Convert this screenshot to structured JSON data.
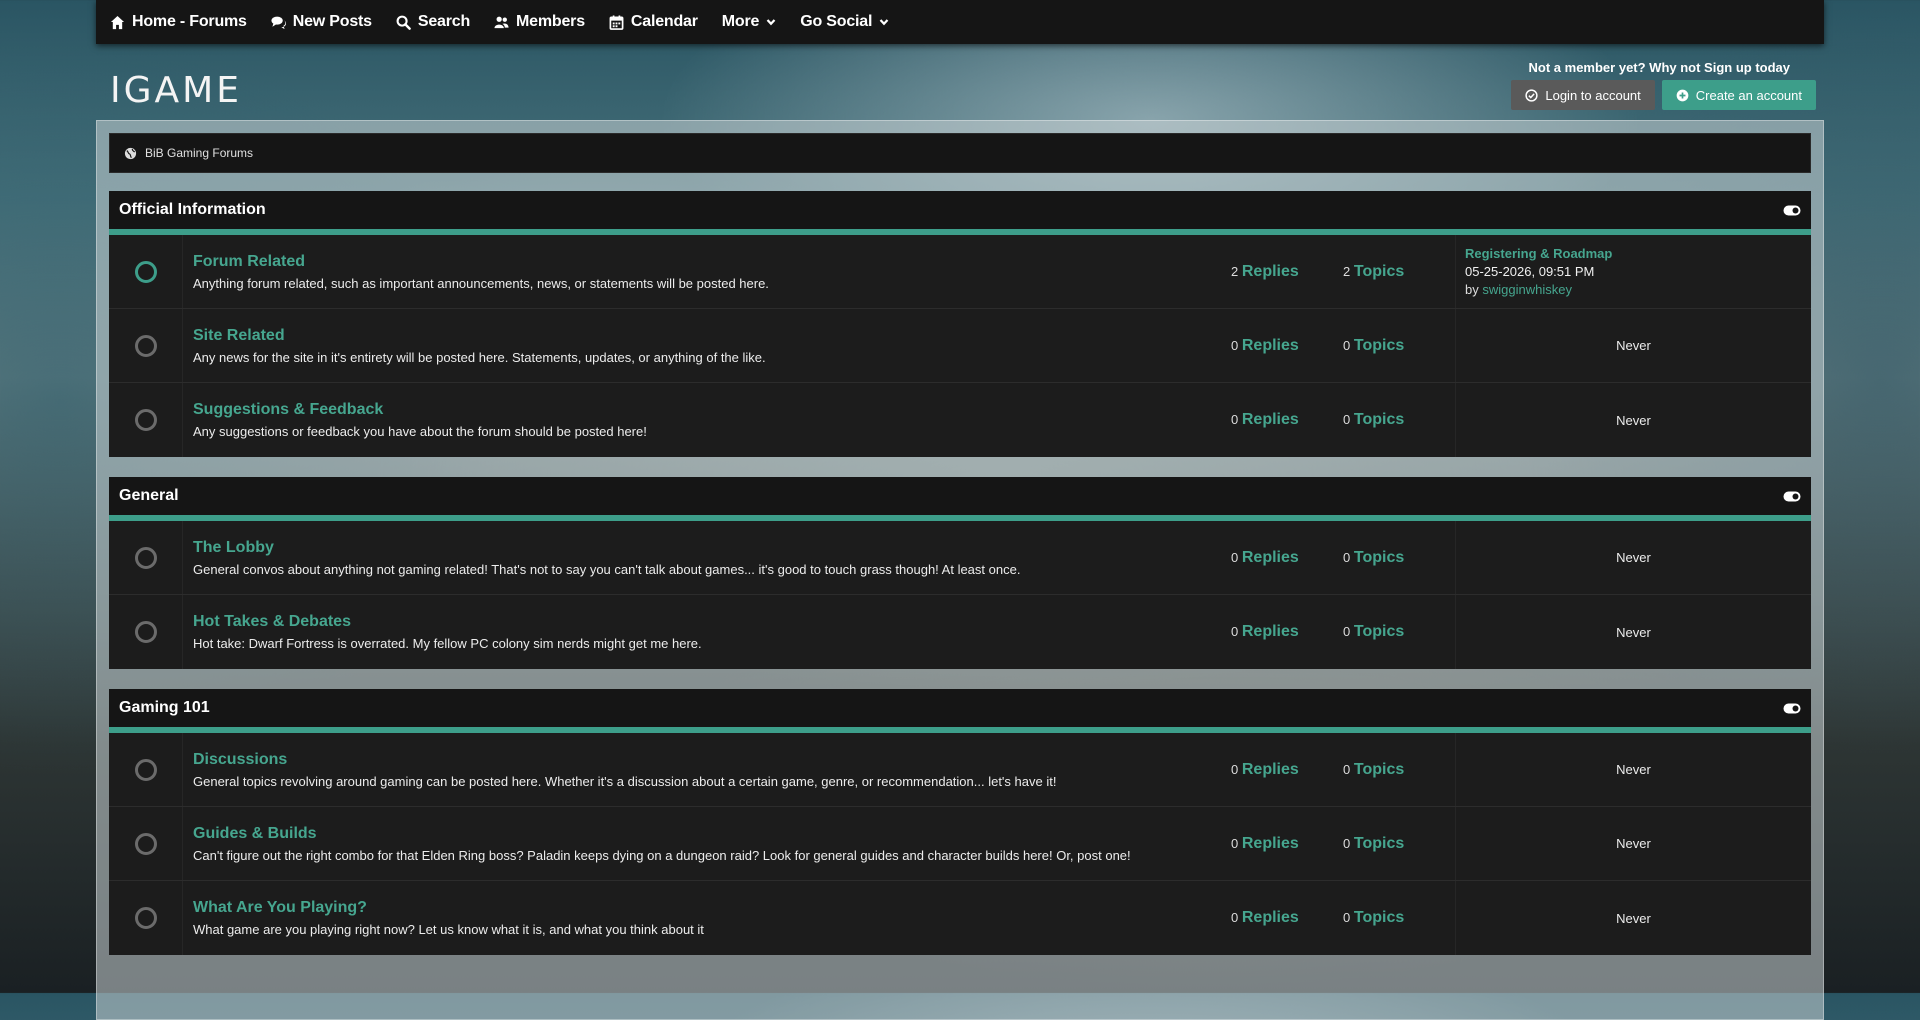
{
  "nav": {
    "items": [
      {
        "label": "Home - Forums",
        "icon": "home-icon"
      },
      {
        "label": "New Posts",
        "icon": "comments-icon"
      },
      {
        "label": "Search",
        "icon": "search-icon"
      },
      {
        "label": "Members",
        "icon": "users-icon"
      },
      {
        "label": "Calendar",
        "icon": "calendar-icon"
      },
      {
        "label": "More",
        "icon": "chevron-down-icon"
      },
      {
        "label": "Go Social",
        "icon": "chevron-down-icon"
      }
    ]
  },
  "header": {
    "logo": "IGAME",
    "member_note": "Not a member yet? Why not Sign up today",
    "login_label": "Login to account",
    "create_label": "Create an account"
  },
  "breadcrumb": "BiB Gaming Forums",
  "colors": {
    "accent": "#3d9e8a",
    "link": "#46a68f",
    "panel": "#151515"
  },
  "categories": [
    {
      "title": "Official Information",
      "forums": [
        {
          "title": "Forum Related",
          "desc": "Anything forum related, such as important announcements, news, or statements will be posted here.",
          "replies": "2",
          "topics": "2",
          "last_title": "Registering & Roadmap",
          "last_date": "05-25-2026, 09:51 PM",
          "last_by_prefix": "by",
          "last_user": "swigginwhiskey"
        },
        {
          "title": "Site Related",
          "desc": "Any news for the site in it's entirety will be posted here. Statements, updates, or anything of the like.",
          "replies": "0",
          "topics": "0",
          "never": "Never"
        },
        {
          "title": "Suggestions & Feedback",
          "desc": "Any suggestions or feedback you have about the forum should be posted here!",
          "replies": "0",
          "topics": "0",
          "never": "Never"
        }
      ]
    },
    {
      "title": "General",
      "forums": [
        {
          "title": "The Lobby",
          "desc": "General convos about anything not gaming related! That's not to say you can't talk about games... it's good to touch grass though! At least once.",
          "replies": "0",
          "topics": "0",
          "never": "Never"
        },
        {
          "title": "Hot Takes & Debates",
          "desc": "Hot take: Dwarf Fortress is overrated. My fellow PC colony sim nerds might get me here.",
          "replies": "0",
          "topics": "0",
          "never": "Never"
        }
      ]
    },
    {
      "title": "Gaming 101",
      "forums": [
        {
          "title": "Discussions",
          "desc": "General topics revolving around gaming can be posted here. Whether it's a discussion about a certain game, genre, or recommendation... let's have it!",
          "replies": "0",
          "topics": "0",
          "never": "Never"
        },
        {
          "title": "Guides & Builds",
          "desc": "Can't figure out the right combo for that Elden Ring boss? Paladin keeps dying on a dungeon raid? Look for general guides and character builds here! Or, post one!",
          "replies": "0",
          "topics": "0",
          "never": "Never"
        },
        {
          "title": "What Are You Playing?",
          "desc": "What game are you playing right now? Let us know what it is, and what you think about it",
          "replies": "0",
          "topics": "0",
          "never": "Never"
        }
      ]
    }
  ],
  "labels": {
    "replies": "Replies",
    "topics": "Topics"
  }
}
